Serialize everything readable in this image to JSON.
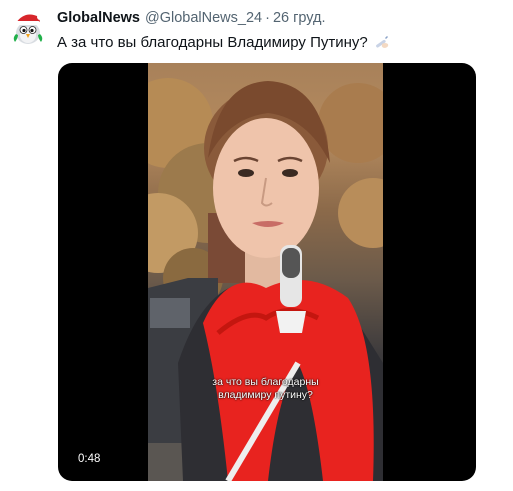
{
  "tweet": {
    "author_name": "GlobalNews",
    "handle": "@GlobalNews_24",
    "separator": "·",
    "date": "26 груд.",
    "text": "А за что вы благодарны Владимиру Путину?",
    "emoji_icon": "writing-hand-icon",
    "avatar_icon": "santa-bird-avatar"
  },
  "media": {
    "caption_line1": "за что вы благодарны",
    "caption_line2": "владимиру путину?",
    "duration": "0:48"
  },
  "colors": {
    "text": "#0f1419",
    "muted": "#536471",
    "media_bg": "#000000",
    "scarf": "#e8231f"
  }
}
